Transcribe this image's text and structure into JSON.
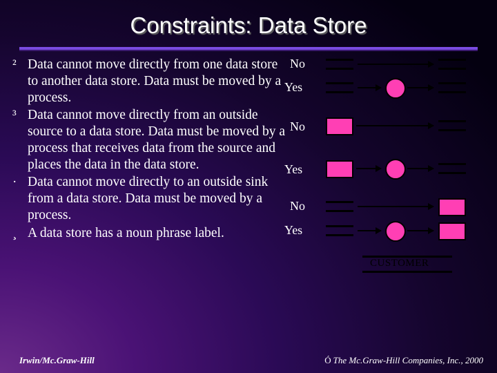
{
  "title": "Constraints: Data Store",
  "bullets": [
    {
      "sym": "²",
      "text": "Data cannot move directly from one data store to another data store.  Data must be moved by a process."
    },
    {
      "sym": "³",
      "text": "Data cannot move directly from an outside source to a data store.  Data must be moved by a process that receives data from the source and places the data in the data store."
    },
    {
      "sym": "·",
      "text": "Data cannot move directly to an outside sink from a data store.  Data must be moved by a process."
    },
    {
      "sym": "¸",
      "text": "A data store has a noun phrase label."
    }
  ],
  "labels": {
    "no1": "No",
    "yes1": "Yes",
    "no2": "No",
    "yes2": "Yes",
    "no3": "No",
    "yes3": "Yes",
    "store": "CUSTOMER"
  },
  "footer": {
    "left": "Irwin/Mc.Graw-Hill",
    "right": "The Mc.Graw-Hill Companies, Inc., 2000",
    "copy": "Ó"
  }
}
